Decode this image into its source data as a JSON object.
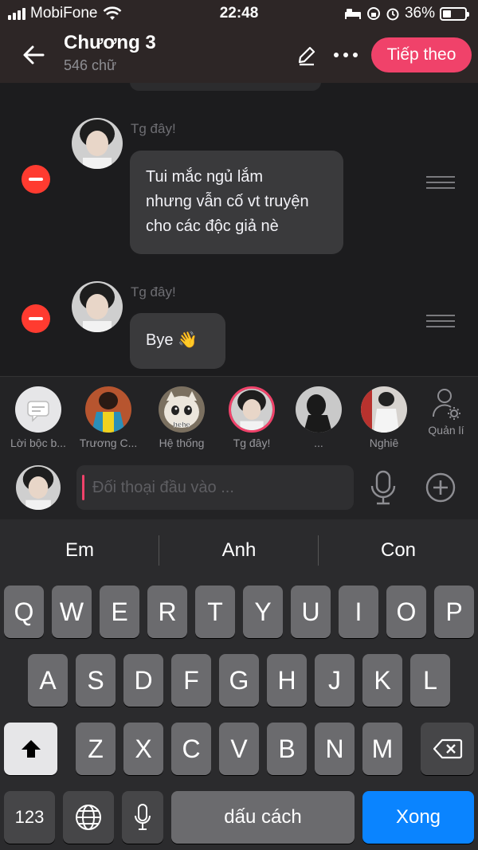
{
  "status": {
    "carrier": "MobiFone",
    "time": "22:48",
    "battery": "36%"
  },
  "header": {
    "title": "Chương 3",
    "subtitle": "546 chữ",
    "next_label": "Tiếp theo"
  },
  "messages": [
    {
      "sender": "Tg đây!",
      "text_lines": [
        "Tui mắc ngủ lắm",
        "nhưng vẫn cố vt truyện",
        "cho các độc giả nè"
      ]
    },
    {
      "sender": "Tg đây!",
      "text_lines": [
        "Bye 👋"
      ]
    }
  ],
  "characters": [
    {
      "name": "Lời bộc b..."
    },
    {
      "name": "Trương C..."
    },
    {
      "name": "Hệ thống",
      "pic_label": "hehe"
    },
    {
      "name": "Tg đây!"
    },
    {
      "name": "..."
    },
    {
      "name": "Nghiê"
    },
    {
      "name": "Quản lí"
    }
  ],
  "composer": {
    "placeholder": "Đối thoại đầu vào ..."
  },
  "keyboard": {
    "suggestions": [
      "Em",
      "Anh",
      "Con"
    ],
    "row1": [
      "Q",
      "W",
      "E",
      "R",
      "T",
      "Y",
      "U",
      "I",
      "O",
      "P"
    ],
    "row2": [
      "A",
      "S",
      "D",
      "F",
      "G",
      "H",
      "J",
      "K",
      "L"
    ],
    "row3": [
      "Z",
      "X",
      "C",
      "V",
      "B",
      "N",
      "M"
    ],
    "numbers_label": "123",
    "space_label": "dấu cách",
    "done_label": "Xong"
  },
  "colors": {
    "accent": "#f0426a",
    "remove": "#ff3b30",
    "done": "#0a84ff"
  }
}
